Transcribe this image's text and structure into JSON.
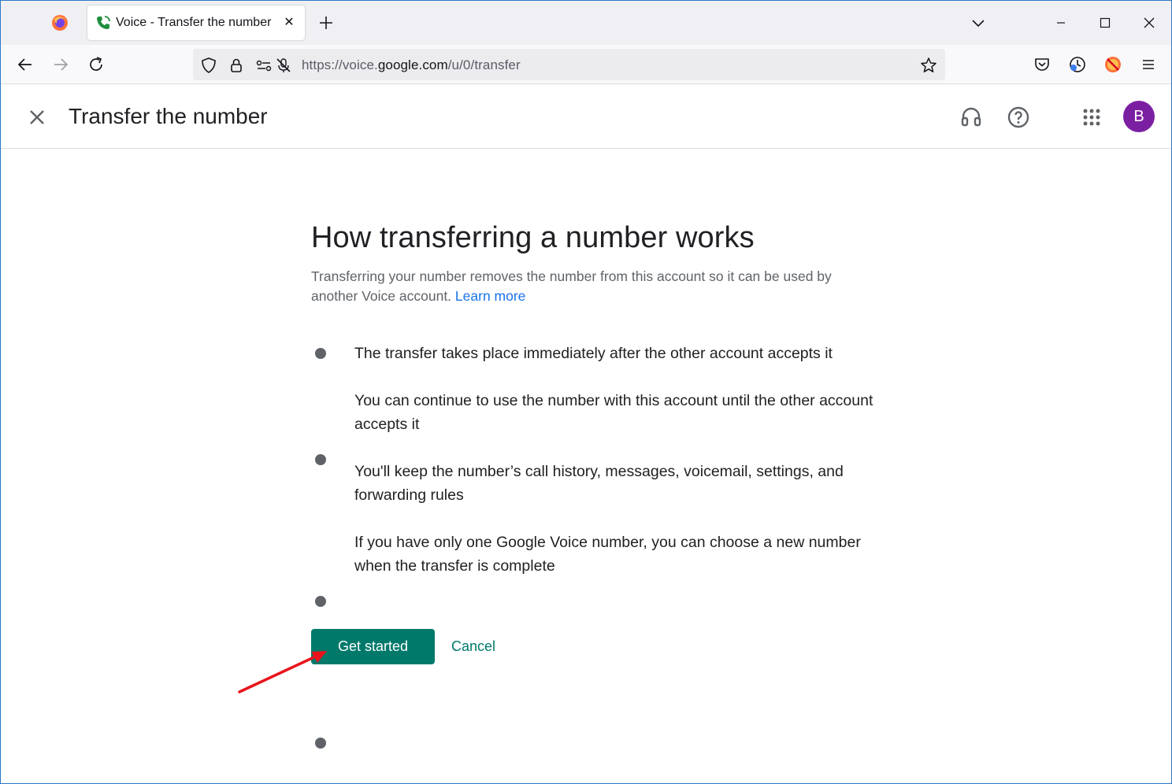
{
  "browser": {
    "tab": {
      "title": "Voice - Transfer the number",
      "close_glyph": "✕"
    },
    "url": {
      "prefix": "https://voice.",
      "host": "google.com",
      "path": "/u/0/transfer"
    },
    "icons": [
      "firefox-icon",
      "new-tab-icon",
      "tab-list-icon",
      "minimize-icon",
      "maximize-icon",
      "close-window-icon",
      "back-icon",
      "forward-icon",
      "reload-icon",
      "tracking-shield-icon",
      "lock-icon",
      "permissions-icon",
      "microphone-blocked-icon",
      "bookmark-star-icon",
      "pocket-icon",
      "extension-icon",
      "blocked-extension-icon",
      "menu-icon"
    ]
  },
  "header": {
    "title": "Transfer the number",
    "avatar_letter": "B",
    "avatar_color": "#7b1fa2"
  },
  "main": {
    "heading": "How transferring a number works",
    "description": "Transferring your number removes the number from this account so it can be used by another Voice account.",
    "learn_more": "Learn more",
    "bullets": [
      "The transfer takes place immediately after the other account accepts it",
      "You can continue to use the number with this account until the other account accepts it",
      "You'll keep the number’s call history, messages, voicemail, settings, and forwarding rules",
      "If you have only one Google Voice number, you can choose a new number when the transfer is complete"
    ],
    "primary_button": "Get started",
    "secondary_button": "Cancel"
  },
  "colors": {
    "accent": "#00796b",
    "link": "#1a73e8",
    "annotation_arrow": "#e8141b"
  }
}
